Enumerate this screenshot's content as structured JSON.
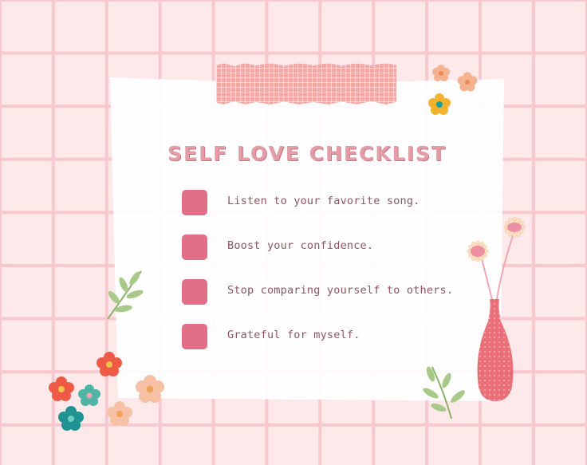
{
  "title": "SELF LOVE CHECKLIST",
  "items": [
    {
      "label": "Listen to your favorite song.",
      "checked": false
    },
    {
      "label": "Boost your confidence.",
      "checked": false
    },
    {
      "label": "Stop comparing yourself to others.",
      "checked": false
    },
    {
      "label": "Grateful for myself.",
      "checked": false
    }
  ],
  "colors": {
    "background": "#fde8ea",
    "grid_line": "#f7c9cf",
    "title": "#e49da7",
    "checkbox": "#e06f87",
    "text": "#8c5560",
    "tape": "#f2a9a3"
  },
  "decorations": [
    "washi-tape",
    "flower-icon",
    "leaf-sprig-icon",
    "vase-icon",
    "daisy-icon"
  ]
}
